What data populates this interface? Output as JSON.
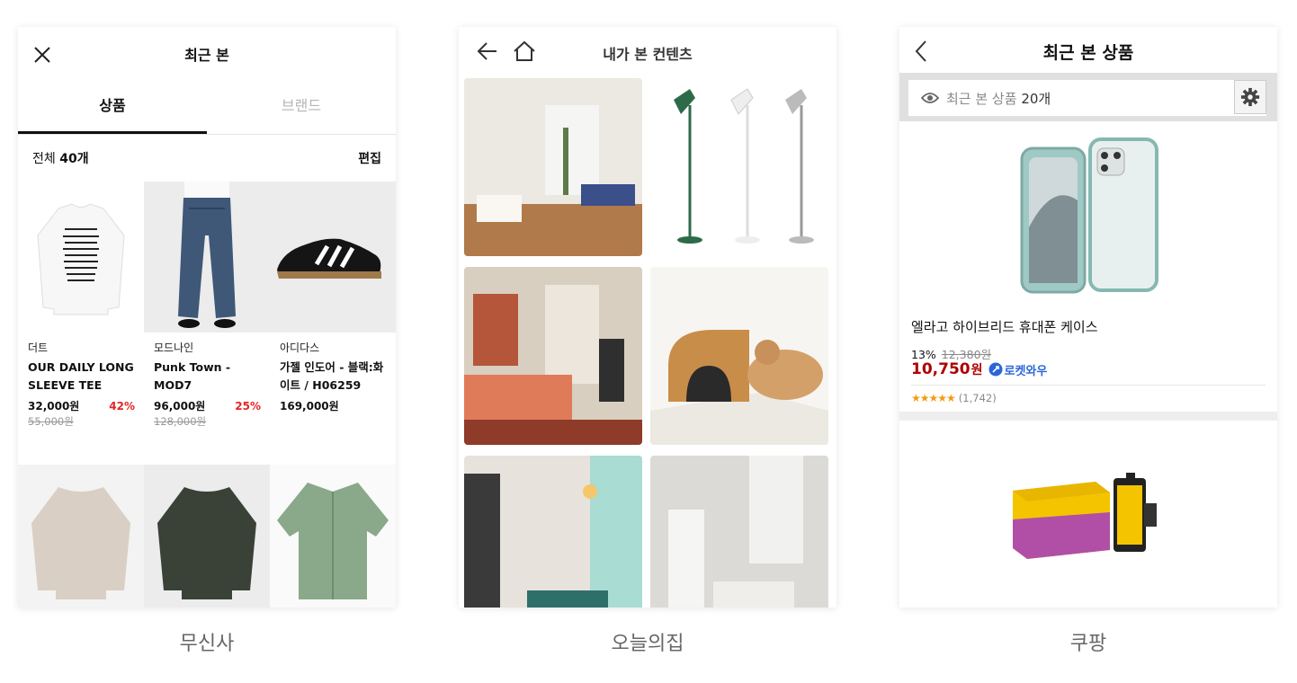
{
  "musinsa": {
    "title": "최근 본",
    "tabs": [
      {
        "label": "상품"
      },
      {
        "label": "브랜드"
      }
    ],
    "count_prefix": "전체 ",
    "count_value": "40개",
    "edit_label": "편집",
    "products": [
      {
        "brand": "더트",
        "name": "OUR DAILY LONG SLEEVE TEE (WHI…",
        "price": "32,000원",
        "discount": "42%",
        "original": "55,000원"
      },
      {
        "brand": "모드나인",
        "name": "Punk Town - MOD7",
        "price": "96,000원",
        "discount": "25%",
        "original": "128,000원"
      },
      {
        "brand": "아디다스",
        "name": "가젤 인도어 - 블랙:화이트 / H06259",
        "price": "169,000원",
        "discount": "",
        "original": ""
      }
    ],
    "caption": "무신사"
  },
  "ohouse": {
    "title": "내가 본 컨텐츠",
    "caption": "오늘의집"
  },
  "coupang": {
    "title": "최근 본 상품",
    "recent_label": "최근 본 상품 ",
    "recent_count": "20개",
    "product": {
      "name": "엘라고 하이브리드 휴대폰 케이스",
      "discount": "13%",
      "original": "12,380원",
      "price": "10,750",
      "won": "원",
      "badge": "로켓와우",
      "rating_count": "(1,742)",
      "rating": 5
    },
    "caption": "쿠팡"
  },
  "colors": {
    "discount_red": "#e32626",
    "coupang_price": "#ae0000",
    "rocket_blue": "#2a66d9",
    "star": "#f39c12"
  }
}
